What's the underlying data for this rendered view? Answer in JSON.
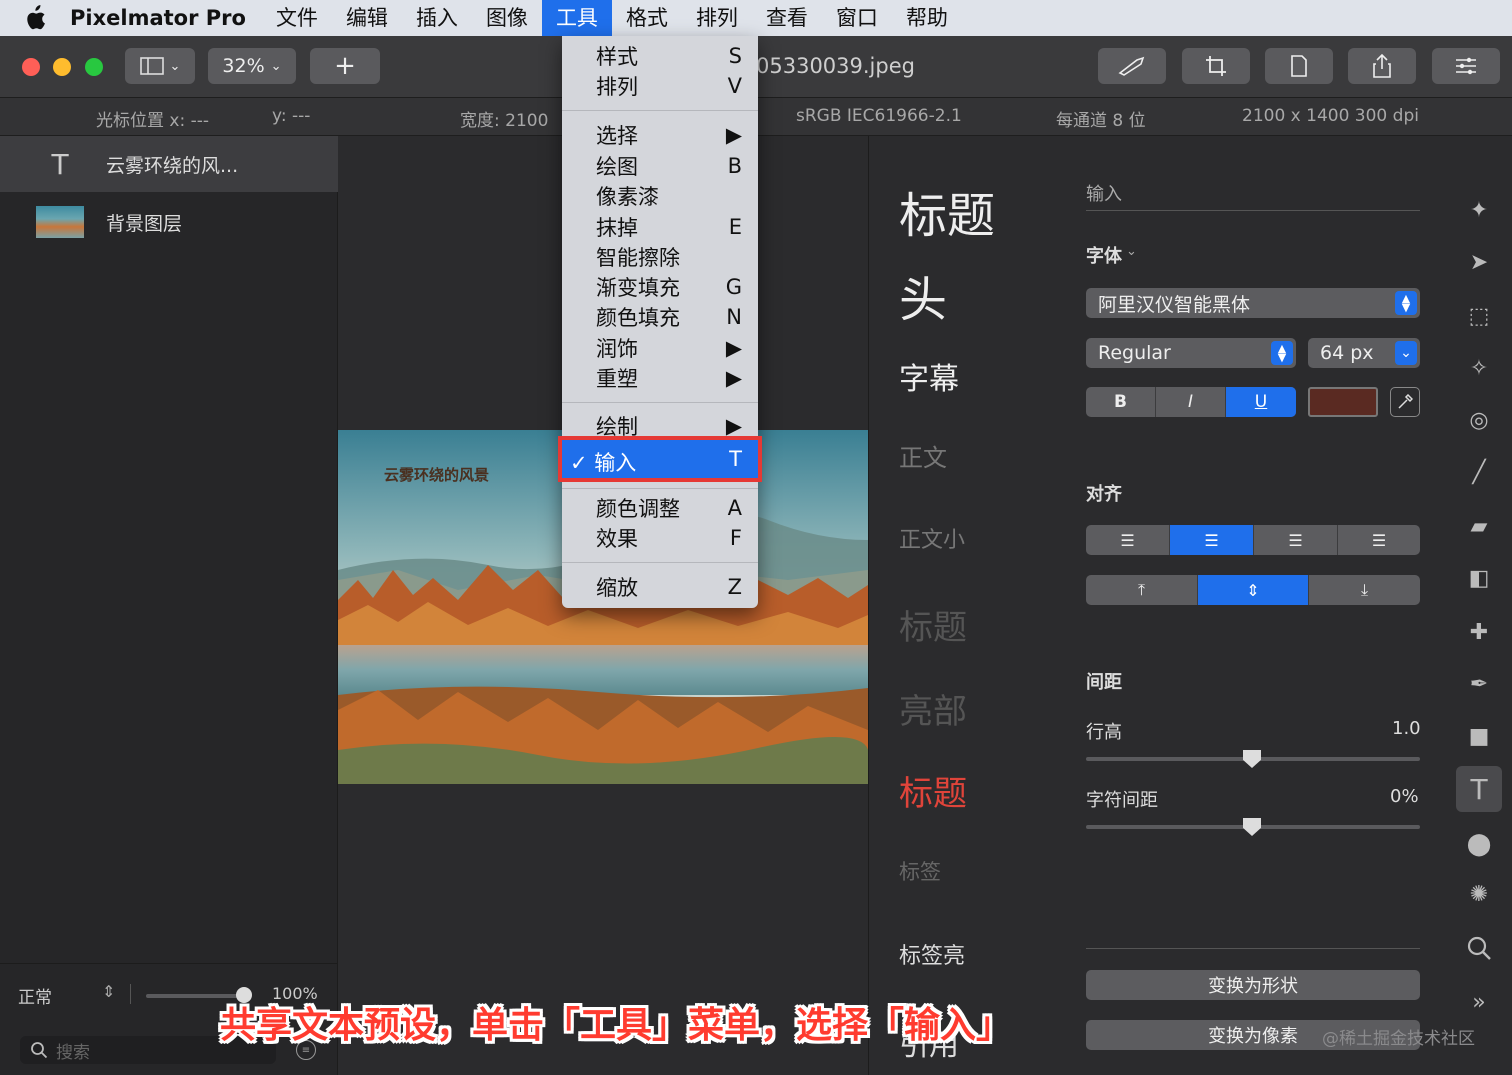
{
  "menubar": {
    "app_name": "Pixelmator Pro",
    "items": [
      "文件",
      "编辑",
      "插入",
      "图像",
      "工具",
      "格式",
      "排列",
      "查看",
      "窗口",
      "帮助"
    ],
    "active_index": 4
  },
  "toolbar": {
    "zoom": "32%",
    "add_label": "+",
    "doc_title": "05330039.jpeg"
  },
  "infobar": {
    "cursor_x": "光标位置 x:  ---",
    "cursor_y": "y:  ---",
    "width": "宽度:  2100",
    "color_profile": "sRGB IEC61966-2.1",
    "bit_depth": "每通道 8 位",
    "dimensions": "2100 x 1400 300 dpi"
  },
  "layers": {
    "items": [
      {
        "name": "云雾环绕的风...",
        "type": "text"
      },
      {
        "name": "背景图层",
        "type": "image"
      }
    ],
    "blend_mode": "正常",
    "opacity": "100%",
    "search_placeholder": "搜索"
  },
  "photo": {
    "overlay_text": "云雾环绕的风景"
  },
  "presets": {
    "items": [
      "标题",
      "头",
      "字幕",
      "正文",
      "正文小",
      "标题",
      "亮部",
      "标题",
      "标签",
      "标签亮",
      "引用"
    ]
  },
  "inspector": {
    "input_label": "输入",
    "font_label": "字体",
    "font_name": "阿里汉仪智能黑体",
    "font_style": "Regular",
    "font_size": "64 px",
    "bold": "B",
    "italic": "I",
    "underline": "U",
    "text_color": "#5a2a22",
    "align_label": "对齐",
    "spacing_label": "间距",
    "line_height_label": "行高",
    "line_height_value": "1.0",
    "char_spacing_label": "字符间距",
    "char_spacing_value": "0%",
    "convert_shape": "变换为形状",
    "convert_pixels": "变换为像素"
  },
  "dropdown": {
    "groups": [
      [
        {
          "label": "样式",
          "shortcut": "S"
        },
        {
          "label": "排列",
          "shortcut": "V"
        }
      ],
      [
        {
          "label": "选择",
          "shortcut": "▶"
        },
        {
          "label": "绘图",
          "shortcut": "B"
        },
        {
          "label": "像素漆",
          "shortcut": ""
        },
        {
          "label": "抹掉",
          "shortcut": "E"
        },
        {
          "label": "智能擦除",
          "shortcut": ""
        },
        {
          "label": "渐变填充",
          "shortcut": "G"
        },
        {
          "label": "颜色填充",
          "shortcut": "N"
        },
        {
          "label": "润饰",
          "shortcut": "▶"
        },
        {
          "label": "重塑",
          "shortcut": "▶"
        }
      ],
      [
        {
          "label": "绘制",
          "shortcut": "▶"
        },
        {
          "label": "✓ 输入",
          "shortcut": "T"
        }
      ],
      [
        {
          "label": "颜色调整",
          "shortcut": "A"
        },
        {
          "label": "效果",
          "shortcut": "F"
        }
      ],
      [
        {
          "label": "缩放",
          "shortcut": "Z"
        }
      ]
    ],
    "highlighted": {
      "label": "✓ 输入",
      "shortcut": "T"
    }
  },
  "caption": "共享文本预设，单击「工具」菜单，选择「输入」",
  "watermark": "@稀土掘金技术社区",
  "colors": {
    "accent": "#1f6feb",
    "highlight_border": "#e53935",
    "preset_red": "#e0443a"
  }
}
